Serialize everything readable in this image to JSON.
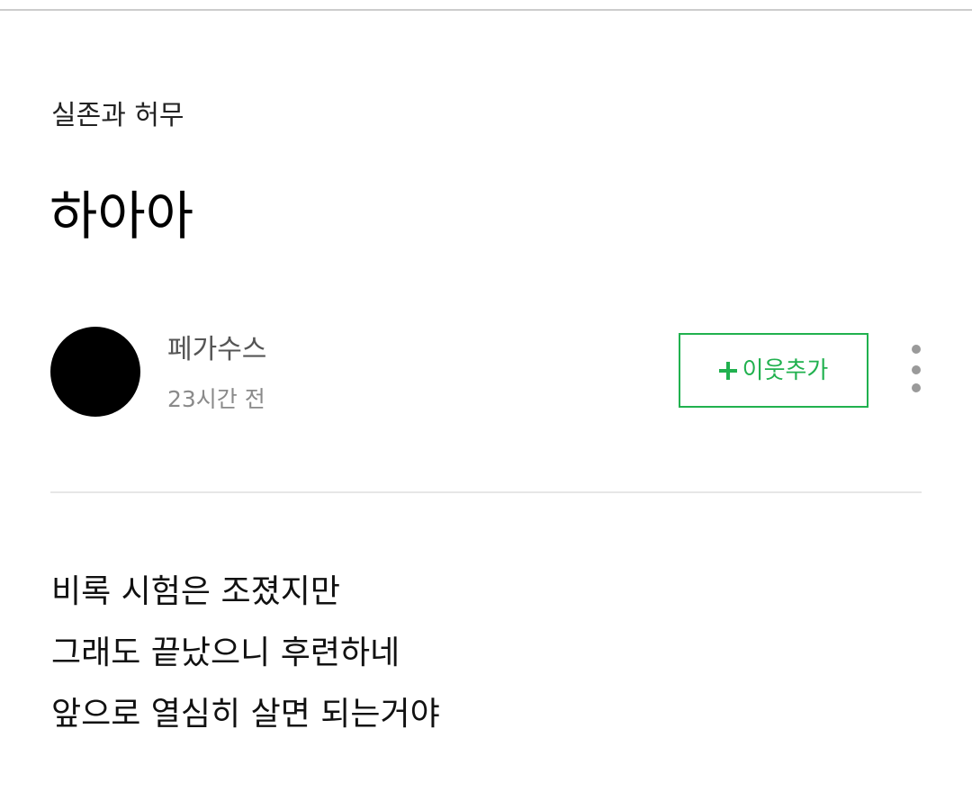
{
  "post": {
    "category": "실존과 허무",
    "title": "하아아",
    "author": {
      "name": "페가수스",
      "time": "23시간 전"
    },
    "follow_button": {
      "icon": "plus-icon",
      "label": "이웃추가"
    },
    "more_icon": "more-vertical-icon",
    "content": [
      "비록 시험은 조졌지만",
      "그래도 끝났으니 후련하네",
      "앞으로 열심히 살면 되는거야"
    ]
  },
  "colors": {
    "accent": "#21b14f",
    "avatar": "#000000",
    "divider": "#e6e6e6"
  }
}
